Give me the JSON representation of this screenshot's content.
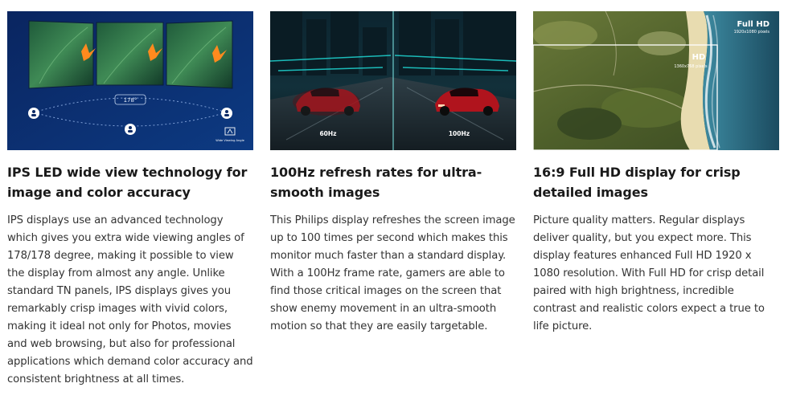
{
  "features": [
    {
      "title": "IPS LED wide view technology for image and color accuracy",
      "body": "IPS displays use an advanced technology which gives you extra wide viewing angles of 178/178 degree, making it possible to view the display from almost any angle. Unlike standard TN panels, IPS displays gives you remarkably crisp images with vivid colors, making it ideal not only for Photos, movies and web browsing, but also for professional applications which demand color accuracy and consistent brightness at all times.",
      "image_label_angle": "178°",
      "image_label_icon": "Wide Viewing Angle"
    },
    {
      "title": "100Hz refresh rates for ultra-smooth images",
      "body": "This Philips display refreshes the screen image up to 100 times per second which makes this monitor much faster than a standard display. With a 100Hz frame rate, gamers are able to find those critical images on the screen that show enemy movement in an ultra-smooth motion so that they are easily targetable.",
      "image_label_left": "60Hz",
      "image_label_right": "100Hz"
    },
    {
      "title": "16:9 Full HD display for crisp detailed images",
      "body": "Picture quality matters. Regular displays deliver quality, but you expect more. This display features enhanced Full HD 1920 x 1080 resolution. With Full HD for crisp detail paired with high brightness, incredible contrast and realistic colors expect a true to life picture.",
      "image_label_fhd": "Full HD",
      "image_label_fhd_res": "1920x1080 pixels",
      "image_label_hd": "HD",
      "image_label_hd_res": "1360x768 pixels"
    }
  ],
  "colors": {
    "ips_bg": "#0b2a66",
    "ips_dot": "#ffffff",
    "car_bg": "#0b1a22",
    "car_red": "#a3141c",
    "aerial_green": "#4d5e2a",
    "sea_blue": "#2f6f86"
  }
}
